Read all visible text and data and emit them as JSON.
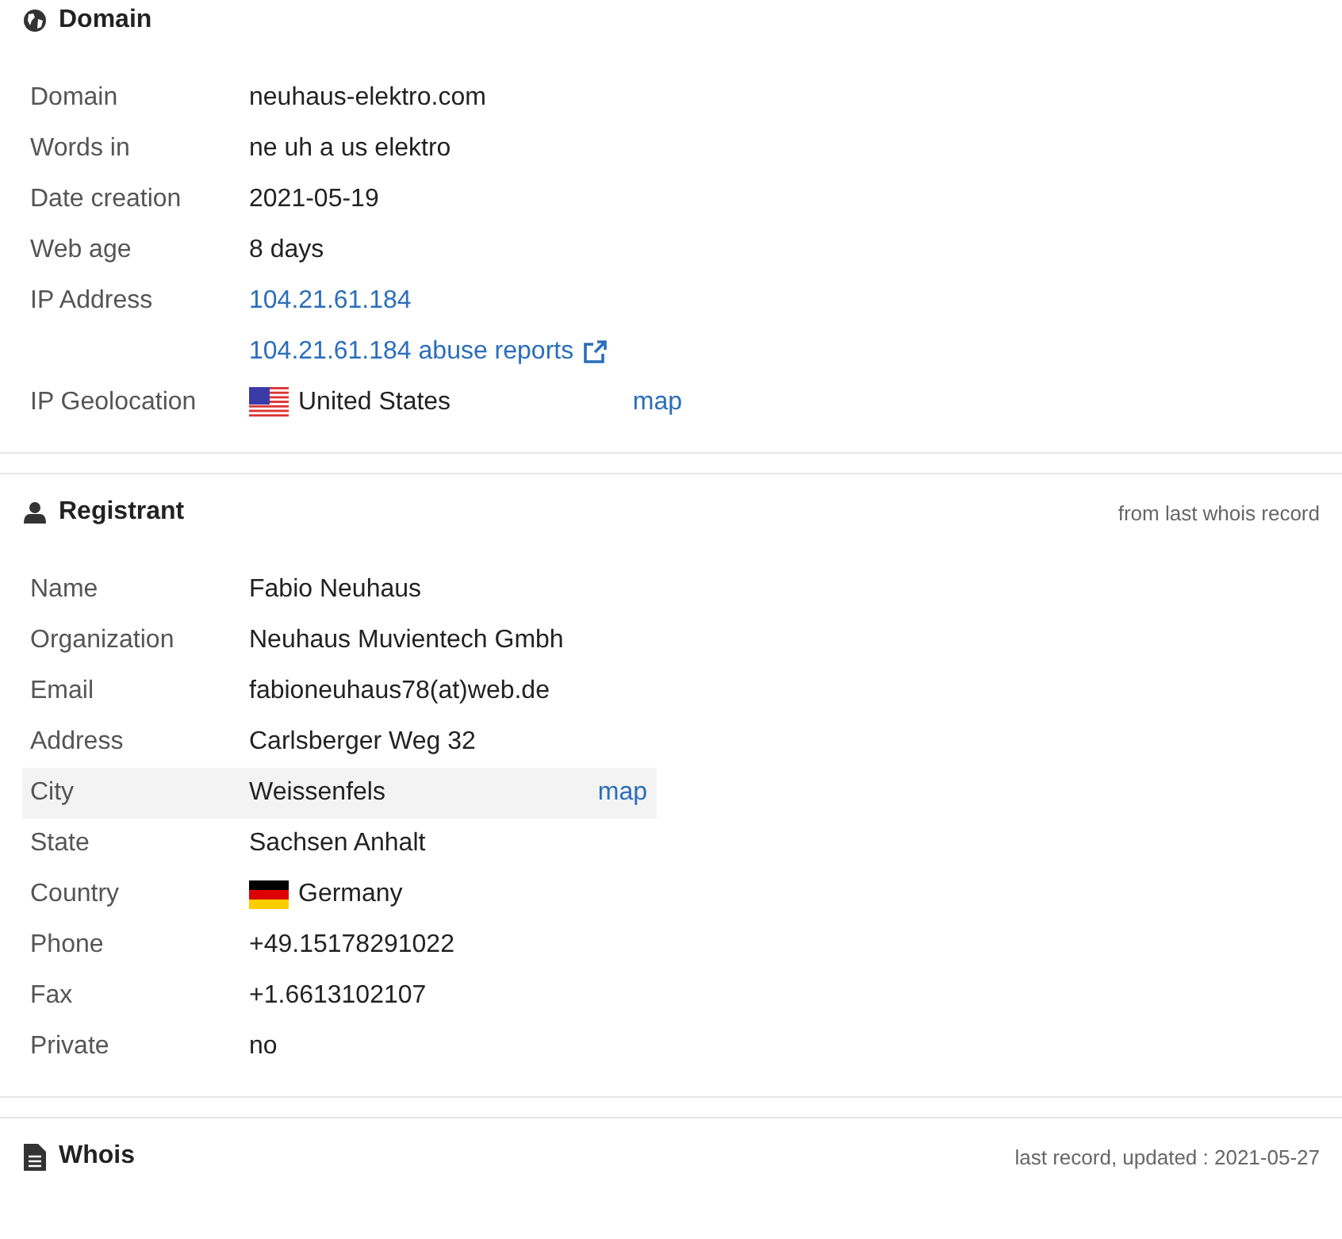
{
  "sections": [
    {
      "title": "Domain",
      "rows": [
        {
          "label": "Domain",
          "value": "neuhaus-elektro.com",
          "kind": "text",
          "highlighted": false
        },
        {
          "label": "Words in",
          "value": "ne uh a us elektro",
          "kind": "text",
          "highlighted": false
        },
        {
          "label": "Date creation",
          "value": "2021-05-19",
          "kind": "text",
          "highlighted": false
        },
        {
          "label": "Web age",
          "value": "8 days",
          "kind": "text",
          "highlighted": false
        },
        {
          "label": "IP Address",
          "value": "104.21.61.184",
          "kind": "link",
          "highlighted": false
        },
        {
          "value": "104.21.61.184 abuse reports",
          "kind": "external-link",
          "highlighted": false
        },
        {
          "label": "IP Geolocation",
          "value": "United States",
          "kind": "flag",
          "map": "map",
          "highlighted": false
        }
      ]
    },
    {
      "title": "Registrant",
      "note": "from last whois record",
      "rows": [
        {
          "label": "Name",
          "value": "Fabio Neuhaus",
          "kind": "text",
          "highlighted": false
        },
        {
          "label": "Organization",
          "value": "Neuhaus Muvientech Gmbh",
          "kind": "text",
          "highlighted": false
        },
        {
          "label": "Email",
          "value": "fabioneuhaus78(at)web.de",
          "kind": "text",
          "highlighted": false
        },
        {
          "label": "Address",
          "value": "Carlsberger Weg 32",
          "kind": "text",
          "highlighted": false
        },
        {
          "label": "City",
          "value": "Weissenfels",
          "kind": "text",
          "map": "map",
          "highlighted": true
        },
        {
          "label": "State",
          "value": "Sachsen Anhalt",
          "kind": "text",
          "highlighted": false
        },
        {
          "label": "Country",
          "value": "Germany",
          "kind": "flag",
          "highlighted": false
        },
        {
          "label": "Phone",
          "value": "+49.15178291022",
          "kind": "text",
          "highlighted": false
        },
        {
          "label": "Fax",
          "value": "+1.6613102107",
          "kind": "text",
          "highlighted": false
        },
        {
          "label": "Private",
          "value": "no",
          "kind": "text",
          "highlighted": false
        }
      ]
    },
    {
      "title": "Whois",
      "note": "last record, updated : 2021-05-27"
    }
  ]
}
